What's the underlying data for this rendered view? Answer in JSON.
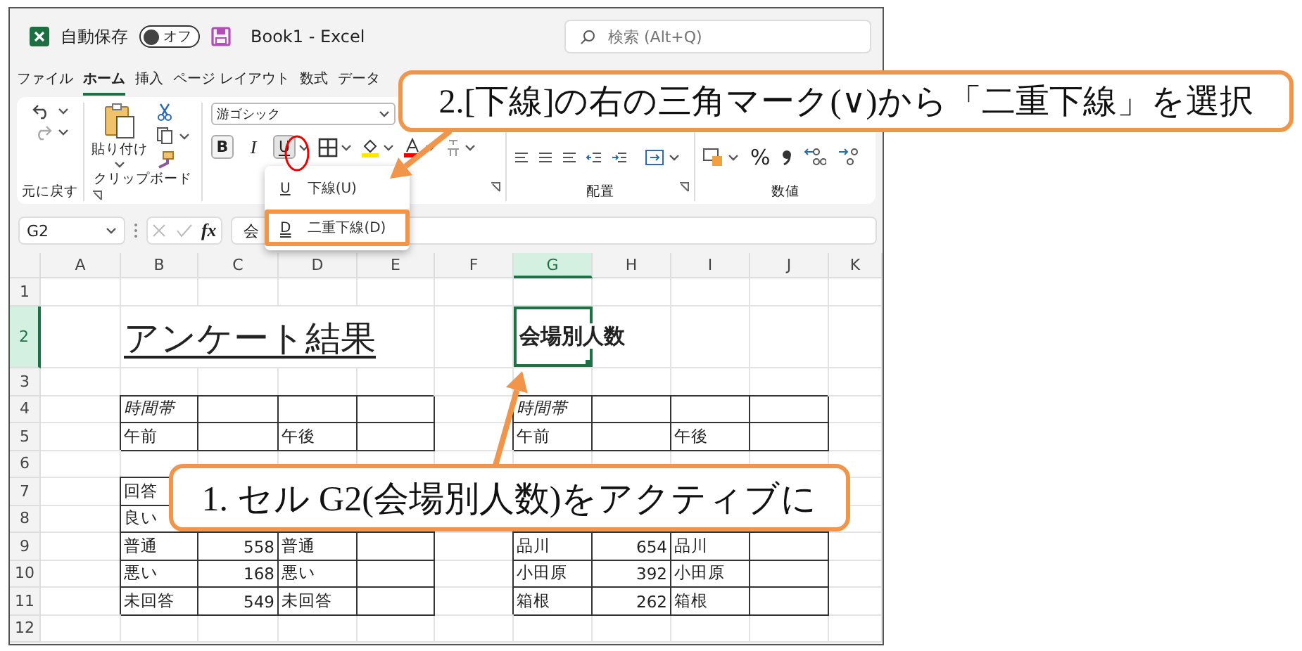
{
  "title_bar": {
    "autosave_label": "自動保存",
    "autosave_toggle": {
      "label": "オフ",
      "on": false
    },
    "document_title": "Book1  -  Excel",
    "search": {
      "placeholder": "検索 (Alt+Q)"
    }
  },
  "menu_tabs": [
    {
      "label": "ファイル",
      "selected": false
    },
    {
      "label": "ホーム",
      "selected": true
    },
    {
      "label": "挿入",
      "selected": false
    },
    {
      "label": "ページ レイアウト",
      "selected": false
    },
    {
      "label": "数式",
      "selected": false
    },
    {
      "label": "データ",
      "selected": false
    }
  ],
  "ribbon": {
    "undo": {
      "label": "元に戻す"
    },
    "clipboard": {
      "label": "クリップボード",
      "paste_label": "貼り付け"
    },
    "font": {
      "font_name": "游ゴシック",
      "bold_key": "B",
      "italic_key": "I",
      "underline_key": "U"
    },
    "alignment": {
      "label": "配置"
    },
    "number": {
      "label": "数値",
      "percent": "%"
    }
  },
  "underline_menu": [
    {
      "icon_text": "U",
      "label": "下線(U)",
      "highlighted": false
    },
    {
      "icon_text": "D",
      "label": "二重下線(D)",
      "highlighted": true
    }
  ],
  "formula_bar": {
    "name_box": "G2",
    "fx_label": "fx",
    "formula": "会"
  },
  "sheet": {
    "columns": [
      {
        "label": "A",
        "selected": false
      },
      {
        "label": "B",
        "selected": false
      },
      {
        "label": "C",
        "selected": false
      },
      {
        "label": "D",
        "selected": false
      },
      {
        "label": "E",
        "selected": false
      },
      {
        "label": "F",
        "selected": false
      },
      {
        "label": "G",
        "selected": true
      },
      {
        "label": "H",
        "selected": false
      },
      {
        "label": "I",
        "selected": false
      },
      {
        "label": "J",
        "selected": false
      },
      {
        "label": "K",
        "selected": false
      }
    ],
    "rows": [
      {
        "label": "1",
        "selected": false
      },
      {
        "label": "2",
        "selected": true
      },
      {
        "label": "3",
        "selected": false
      },
      {
        "label": "4",
        "selected": false
      },
      {
        "label": "5",
        "selected": false
      },
      {
        "label": "6",
        "selected": false
      },
      {
        "label": "7",
        "selected": false
      },
      {
        "label": "8",
        "selected": false
      },
      {
        "label": "9",
        "selected": false
      },
      {
        "label": "10",
        "selected": false
      },
      {
        "label": "11",
        "selected": false
      },
      {
        "label": "12",
        "selected": false
      }
    ],
    "title": {
      "text": "アンケート結果"
    },
    "active_cell": {
      "text": "会場別人数",
      "selected": true
    },
    "tables": [
      {
        "rows": [
          [
            {
              "kind": "italic",
              "text": "時間帯"
            },
            null,
            null,
            null
          ],
          [
            {
              "kind": "text",
              "text": "午前"
            },
            null,
            {
              "kind": "text",
              "text": "午後"
            },
            null
          ]
        ]
      },
      {
        "rows": [
          [
            {
              "kind": "italic",
              "text": "時間帯"
            },
            null,
            null,
            null
          ],
          [
            {
              "kind": "text",
              "text": "午前"
            },
            null,
            {
              "kind": "text",
              "text": "午後"
            },
            null
          ]
        ]
      },
      {
        "rows": [
          [
            {
              "kind": "text",
              "text": "回答"
            },
            null,
            null,
            null
          ],
          [
            {
              "kind": "text",
              "text": "良い"
            },
            null,
            null,
            null
          ],
          [
            {
              "kind": "text",
              "text": "普通"
            },
            {
              "kind": "number",
              "text": "558"
            },
            {
              "kind": "text",
              "text": "普通"
            },
            null
          ],
          [
            {
              "kind": "text",
              "text": "悪い"
            },
            {
              "kind": "number",
              "text": "168"
            },
            {
              "kind": "text",
              "text": "悪い"
            },
            null
          ],
          [
            {
              "kind": "text",
              "text": "未回答"
            },
            {
              "kind": "number",
              "text": "549"
            },
            {
              "kind": "text",
              "text": "未回答"
            },
            null
          ]
        ]
      },
      {
        "rows": [
          [
            null,
            null,
            null,
            null
          ],
          [
            null,
            null,
            null,
            null
          ],
          [
            {
              "kind": "text",
              "text": "品川"
            },
            {
              "kind": "number",
              "text": "654"
            },
            {
              "kind": "text",
              "text": "品川"
            },
            null
          ],
          [
            {
              "kind": "text",
              "text": "小田原"
            },
            {
              "kind": "number",
              "text": "392"
            },
            {
              "kind": "text",
              "text": "小田原"
            },
            null
          ],
          [
            {
              "kind": "text",
              "text": "箱根"
            },
            {
              "kind": "number",
              "text": "262"
            },
            {
              "kind": "text",
              "text": "箱根"
            },
            null
          ]
        ]
      }
    ]
  },
  "callouts": [
    {
      "text": "2.[下線]の右の三角マーク(∨)から「二重下線」を選択"
    },
    {
      "text": "1.  セル G2(会場別人数)をアクティブに"
    }
  ]
}
